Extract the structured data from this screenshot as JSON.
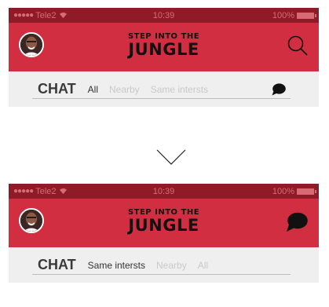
{
  "top": {
    "status": {
      "carrier": "Tele2",
      "time": "10:39",
      "battery": "100%"
    },
    "brand": {
      "line1": "STEP INTO THE",
      "line2": "JUNGLE"
    },
    "tabs": {
      "title": "CHAT",
      "items": [
        "All",
        "Nearby",
        "Same intersts"
      ],
      "active": "All"
    },
    "header_right_icon": "search-icon"
  },
  "bottom": {
    "status": {
      "carrier": "Tele2",
      "time": "10:39",
      "battery": "100%"
    },
    "brand": {
      "line1": "STEP INTO THE",
      "line2": "JUNGLE"
    },
    "tabs": {
      "title": "CHAT",
      "items": [
        "Same intersts",
        "Nearby",
        "All"
      ],
      "active": "Same intersts"
    },
    "header_right_icon": "chat-bubble-icon"
  },
  "colors": {
    "status_bg": "#8f1a28",
    "header_bg": "#d12e42",
    "tabbar_bg": "#efefef"
  },
  "transition_icon": "chevron-down-icon"
}
